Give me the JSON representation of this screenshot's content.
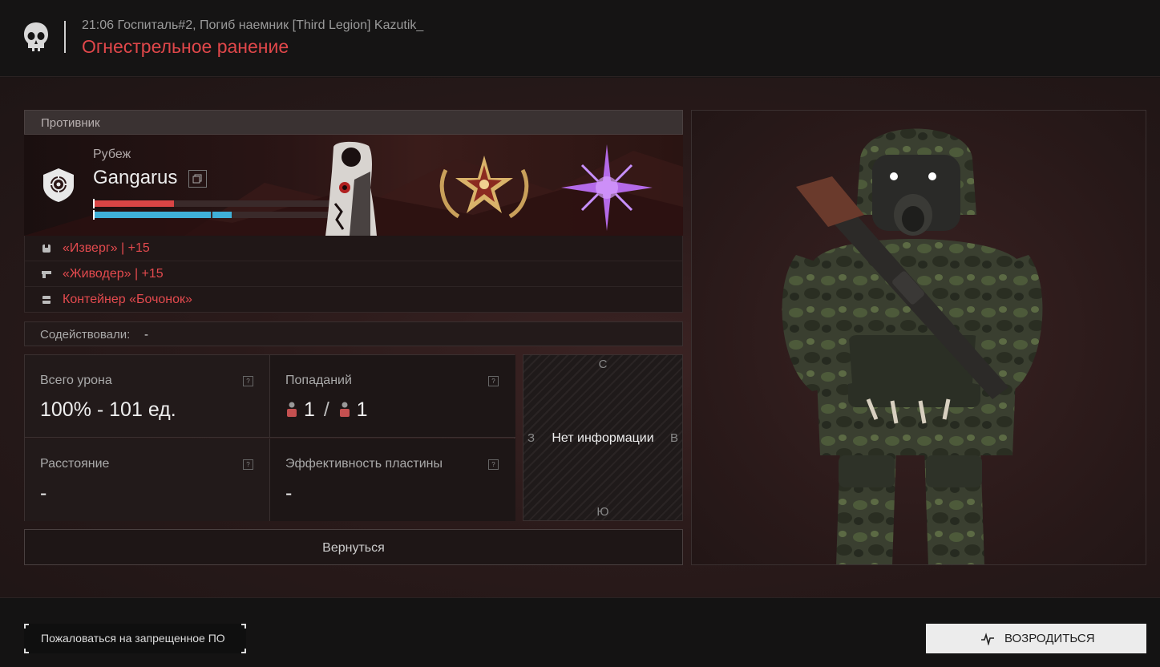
{
  "header": {
    "event_line": "21:06 Госпиталь#2, Погиб наемник [Third Legion] Kazutik_",
    "cause": "Огнестрельное ранение"
  },
  "opponent": {
    "section_title": "Противник",
    "clan": "Рубеж",
    "nickname": "Gangarus",
    "health_fraction": 0.34,
    "armor_fraction": 0.58,
    "kills": [
      {
        "icon": "armor-icon",
        "text": "«Изверг» | +15"
      },
      {
        "icon": "pistol-icon",
        "text": "«Живодер» | +15"
      },
      {
        "icon": "container-icon",
        "text": "Контейнер «Бочонок»"
      }
    ]
  },
  "assist": {
    "label": "Содействовали:",
    "value": "-"
  },
  "stats": {
    "total_damage": {
      "title": "Всего урона",
      "value": "100% - 101 ед.",
      "help": "?"
    },
    "hits": {
      "title": "Попаданий",
      "first": "1",
      "separator": "/",
      "second": "1",
      "help": "?"
    },
    "distance": {
      "title": "Расстояние",
      "value": "-",
      "help": "?"
    },
    "plate_efficiency": {
      "title": "Эффективность пластины",
      "value": "-",
      "help": "?"
    }
  },
  "compass": {
    "north": "С",
    "south": "Ю",
    "west": "З",
    "east": "В",
    "no_info": "Нет информации"
  },
  "back_button": "Вернуться",
  "footer": {
    "report_button": "Пожаловаться на запрещенное ПО",
    "respawn_button": "ВОЗРОДИТЬСЯ"
  },
  "colors": {
    "accent_red": "#e0474a",
    "health": "#d94545",
    "armor": "#3fb0d8"
  }
}
